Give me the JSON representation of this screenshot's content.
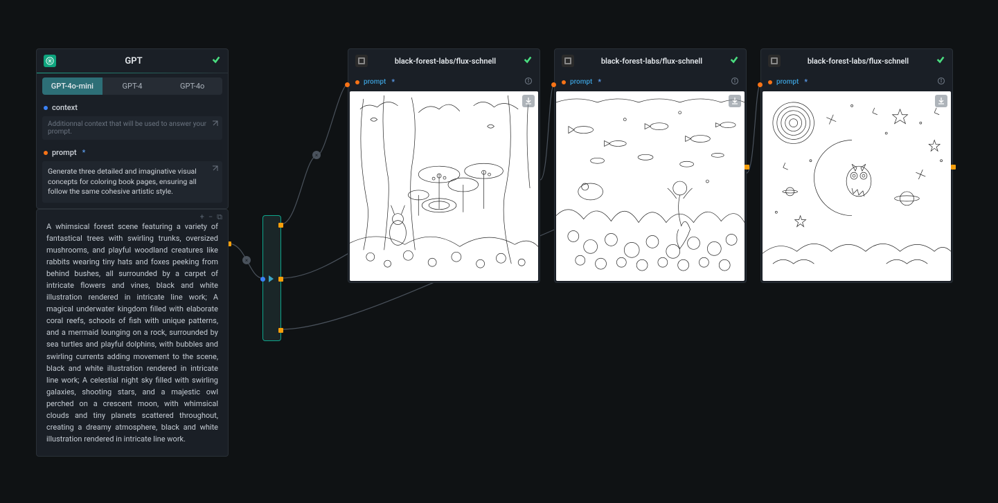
{
  "gpt_node": {
    "title": "GPT",
    "tabs": [
      "GPT-4o-mini",
      "GPT-4",
      "GPT-4o"
    ],
    "active_tab_index": 0,
    "params": {
      "context": {
        "label": "context",
        "placeholder": "Additionnal context that will be used to answer your prompt."
      },
      "prompt": {
        "label": "prompt",
        "required": true,
        "value": "Generate three detailed and imaginative visual concepts for coloring book pages, ensuring all follow the same cohesive artistic style."
      }
    }
  },
  "gpt_output": {
    "text": "A whimsical forest scene featuring a variety of fantastical trees with swirling trunks, oversized mushrooms, and playful woodland creatures like rabbits wearing tiny hats and foxes peeking from behind bushes, all surrounded by a carpet of intricate flowers and vines, black and white illustration rendered in intricate line work; A magical underwater kingdom filled with elaborate coral reefs, schools of fish with unique patterns, and a mermaid lounging on a rock, surrounded by sea turtles and playful dolphins, with bubbles and swirling currents adding movement to the scene, black and white illustration rendered in intricate line work; A celestial night sky filled with swirling galaxies, shooting stars, and a majestic owl perched on a crescent moon, with whimsical clouds and tiny planets scattered throughout, creating a dreamy atmosphere, black and white illustration rendered in intricate line work."
  },
  "flux_nodes": [
    {
      "title": "black-forest-labs/flux-schnell",
      "prompt_label": "prompt"
    },
    {
      "title": "black-forest-labs/flux-schnell",
      "prompt_label": "prompt"
    },
    {
      "title": "black-forest-labs/flux-schnell",
      "prompt_label": "prompt"
    }
  ]
}
